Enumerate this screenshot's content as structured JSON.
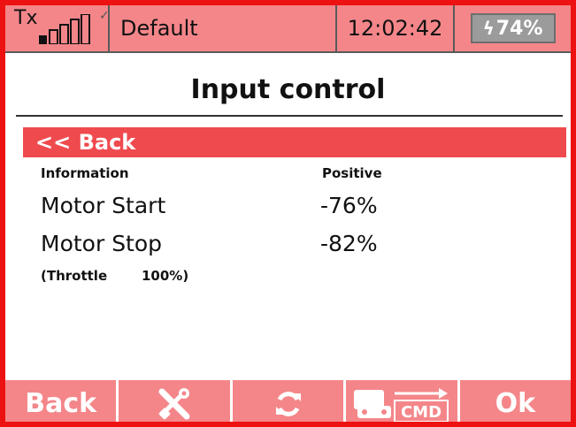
{
  "statusbar": {
    "tx_label": "Tx",
    "tx_signal_icon": "signal-bars-icon",
    "profile": "Default",
    "time": "12:02:42",
    "battery_level": "74%",
    "battery_icon": "battery-charging-icon"
  },
  "page": {
    "title": "Input control",
    "back_label": "<< Back"
  },
  "info": {
    "information_label": "Information",
    "positive_label": "Positive",
    "rows": [
      {
        "label": "Motor Start",
        "value": "-76%"
      },
      {
        "label": "Motor Stop",
        "value": "-82%"
      }
    ],
    "throttle_label": "(Throttle",
    "throttle_value": "100%)"
  },
  "bottombar": {
    "back_label": "Back",
    "tools_icon": "tools-icon",
    "refresh_icon": "refresh-icon",
    "cmd_label": "CMD",
    "cmd_icon": "transmitter-cmd-icon",
    "ok_label": "Ok"
  },
  "colors": {
    "frame": "#ee1111",
    "bar_pink": "#f4868a",
    "highlight_red": "#ef4a4e"
  }
}
